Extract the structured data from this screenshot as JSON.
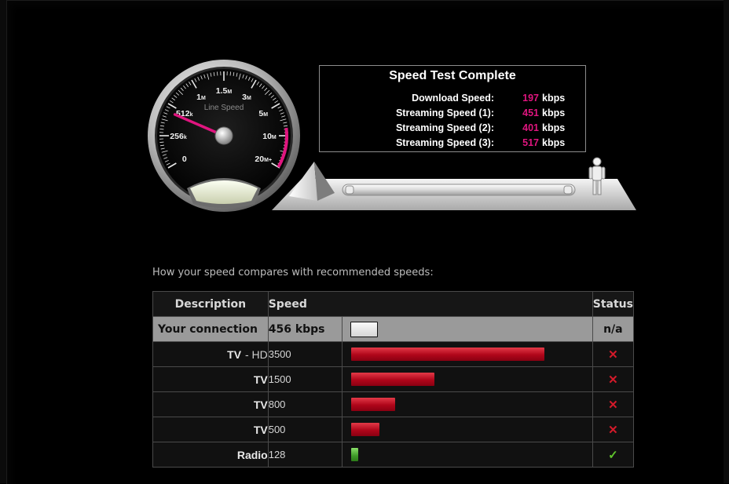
{
  "gauge": {
    "center_label": "Line Speed",
    "scale": [
      {
        "text": "0",
        "unit": ""
      },
      {
        "text": "256",
        "unit": "k"
      },
      {
        "text": "512",
        "unit": "k"
      },
      {
        "text": "1",
        "unit": "M"
      },
      {
        "text": "1.5",
        "unit": "M"
      },
      {
        "text": "3",
        "unit": "M"
      },
      {
        "text": "5",
        "unit": "M"
      },
      {
        "text": "10",
        "unit": "M"
      },
      {
        "text": "20",
        "unit": "M+"
      }
    ],
    "needle_value_kbps": 456,
    "accent_color": "#e0157f"
  },
  "results": {
    "title": "Speed Test Complete",
    "rows": [
      {
        "label": "Download Speed:",
        "value": "197",
        "unit": "kbps"
      },
      {
        "label": "Streaming Speed (1):",
        "value": "451",
        "unit": "kbps"
      },
      {
        "label": "Streaming Speed (2):",
        "value": "401",
        "unit": "kbps"
      },
      {
        "label": "Streaming Speed (3):",
        "value": "517",
        "unit": "kbps"
      }
    ]
  },
  "comparison": {
    "caption": "How your speed compares with recommended speeds:",
    "headers": {
      "description": "Description",
      "speed": "Speed",
      "status": "Status"
    },
    "your_connection": {
      "label": "Your connection",
      "speed": "456 kbps",
      "status": "n/a"
    },
    "rows": [
      {
        "label": "TV",
        "sub": "- HD",
        "speed": "3500",
        "bar_fraction": 0.79,
        "status": "fail"
      },
      {
        "label": "TV",
        "sub": "",
        "speed": "1500",
        "bar_fraction": 0.34,
        "status": "fail"
      },
      {
        "label": "TV",
        "sub": "",
        "speed": "800",
        "bar_fraction": 0.18,
        "status": "fail"
      },
      {
        "label": "TV",
        "sub": "",
        "speed": "500",
        "bar_fraction": 0.115,
        "status": "fail"
      },
      {
        "label": "Radio",
        "sub": "",
        "speed": "128",
        "bar_fraction": 0.03,
        "status": "pass"
      }
    ],
    "your_bar_fraction": 0.105,
    "status_icons": {
      "fail": "✕",
      "pass": "✓"
    },
    "colors": {
      "fail": "#d41a2a",
      "pass": "#5fc42c"
    }
  }
}
